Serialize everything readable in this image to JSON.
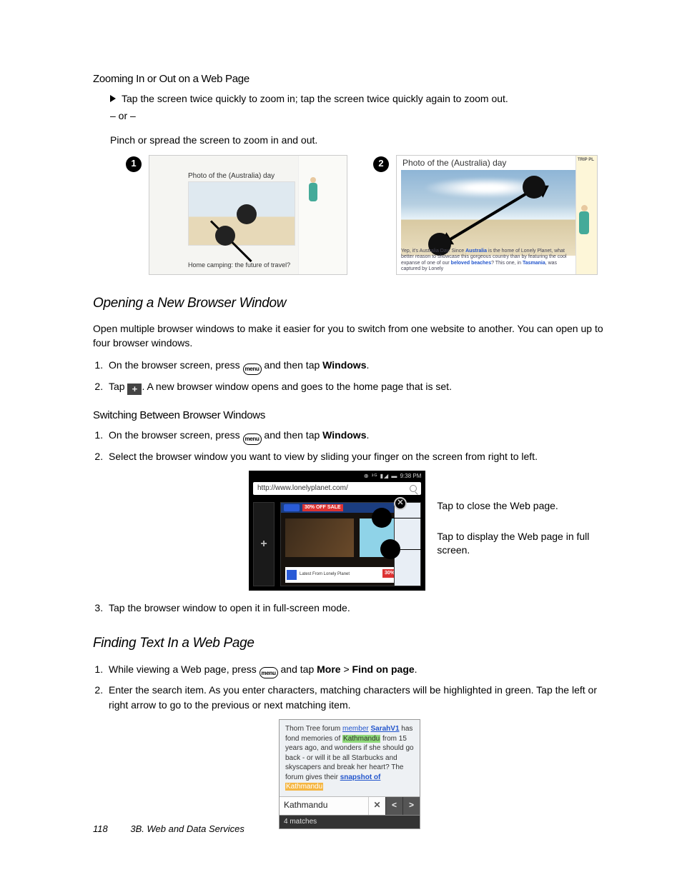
{
  "zoom": {
    "heading": "Zooming In or Out on a Web Page",
    "bullet": "Tap the screen twice quickly to zoom in; tap the screen twice quickly again to zoom out.",
    "or": "– or –",
    "pinch": "Pinch or spread the screen to zoom in and out."
  },
  "fig1": {
    "num": "1",
    "hdr": "Photo of the (Australia) day",
    "cap2": "Home camping: the future of travel?"
  },
  "fig2": {
    "num": "2",
    "title": "Photo of the (Australia) day",
    "sidebar_hdr": "TRIP PL",
    "caption_pre": "Yep, it's Australia Day. Since ",
    "caption_bold1": "Australia",
    "caption_mid": " is the home of Lonely Planet, what better reason to showcase this gorgeous country than by featuring the cool expanse of one of our ",
    "caption_bold2": "beloved beaches",
    "caption_post": "? This one, in ",
    "caption_bold3": "Tasmania",
    "caption_end": ", was captured by Lonely"
  },
  "newwin": {
    "heading": "Opening a New Browser Window",
    "intro": "Open multiple browser windows to make it easier for you to switch from one website to another. You can open up to four browser windows.",
    "s1_pre": "On the browser screen, press ",
    "s1_post": " and then tap ",
    "s1_bold": "Windows",
    "s1_end": ".",
    "s2_pre": "Tap ",
    "s2_post": ". A new browser window opens and goes to the home page that is set."
  },
  "switch": {
    "heading": "Switching Between Browser Windows",
    "s1_pre": "On the browser screen, press ",
    "s1_post": " and then tap ",
    "s1_bold": "Windows",
    "s1_end": ".",
    "s2": "Select the browser window you want to view by sliding your finger on the screen from right to left.",
    "s3": "Tap the browser window to open it in full-screen mode."
  },
  "fig3": {
    "time": "9:38 PM",
    "url": "http://www.lonelyplanet.com/",
    "sale": "30% OFF SALE",
    "latest": "Latest From Lonely Planet",
    "sale2": "30%",
    "annot1": "Tap to close the Web page.",
    "annot2": "Tap to display the Web page in full screen."
  },
  "find": {
    "heading": "Finding Text In a Web Page",
    "s1_pre": "While viewing a Web page, press ",
    "s1_mid": " and tap ",
    "s1_b1": "More",
    "s1_gt": ">",
    "s1_b2": "Find on page",
    "s1_end": ".",
    "s2": "Enter the search item. As you enter characters, matching characters will be highlighted in green. Tap the left or right arrow to go to the previous or next matching item."
  },
  "fig4": {
    "t1": "Thorn Tree forum ",
    "member": "member",
    "sp": " ",
    "sarah": "SarahV1",
    "t2": " has fond memories of ",
    "kath1": "Kathmandu",
    "t3": " from 15 years ago, and wonders if she should go back - or will it be all Starbucks and skyscapers and break her heart? The forum gives their ",
    "snap": "snapshot of",
    "sp2": " ",
    "kath2": "Kathmandu",
    "input": "Kathmandu",
    "matches": "4 matches"
  },
  "footer": {
    "page": "118",
    "chapter": "3B. Web and Data Services"
  },
  "icons": {
    "menu": "menu"
  }
}
